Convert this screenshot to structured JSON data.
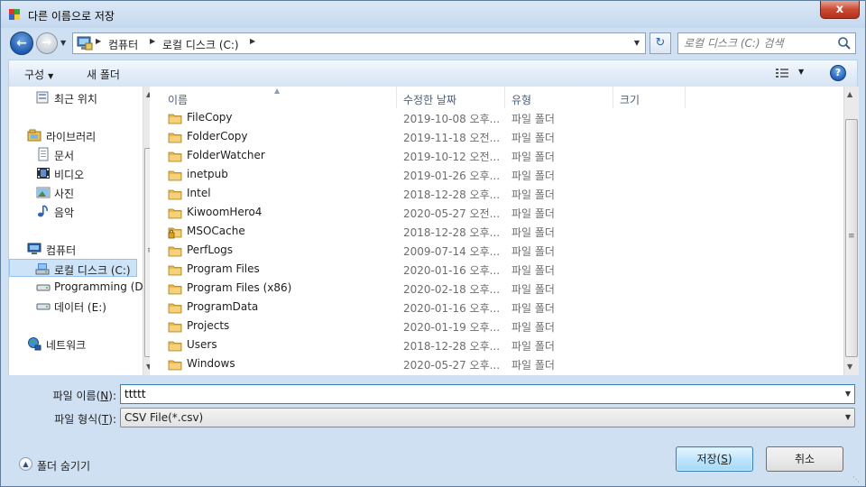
{
  "window": {
    "title": "다른 이름으로 저장",
    "close_label": "x"
  },
  "address": {
    "crumbs": [
      "컴퓨터",
      "로컬 디스크 (C:)"
    ]
  },
  "search": {
    "placeholder": "로컬 디스크 (C:) 검색"
  },
  "toolbar": {
    "organize_label": "구성",
    "new_folder_label": "새 폴더",
    "help_label": "?"
  },
  "nav": {
    "items": [
      {
        "label": "최근 위치",
        "icon": "recent-places-icon"
      },
      {
        "label": "라이브러리",
        "icon": "libraries-icon"
      },
      {
        "label": "문서",
        "icon": "documents-icon"
      },
      {
        "label": "비디오",
        "icon": "videos-icon"
      },
      {
        "label": "사진",
        "icon": "pictures-icon"
      },
      {
        "label": "음악",
        "icon": "music-icon"
      },
      {
        "label": "컴퓨터",
        "icon": "computer-icon"
      },
      {
        "label": "로컬 디스크 (C:)",
        "icon": "local-disk-icon",
        "selected": true
      },
      {
        "label": "Programming (D",
        "icon": "drive-icon"
      },
      {
        "label": "데이터 (E:)",
        "icon": "drive-icon"
      },
      {
        "label": "네트워크",
        "icon": "network-icon"
      }
    ]
  },
  "columns": {
    "name": "이름",
    "modified": "수정한 날짜",
    "type": "유형",
    "size": "크기"
  },
  "files": [
    {
      "name": "FileCopy",
      "date": "2019-10-08 오후...",
      "type": "파일 폴더",
      "icon": "folder-icon"
    },
    {
      "name": "FolderCopy",
      "date": "2019-11-18 오전...",
      "type": "파일 폴더",
      "icon": "folder-icon"
    },
    {
      "name": "FolderWatcher",
      "date": "2019-10-12 오전...",
      "type": "파일 폴더",
      "icon": "folder-icon"
    },
    {
      "name": "inetpub",
      "date": "2019-01-26 오후...",
      "type": "파일 폴더",
      "icon": "folder-icon"
    },
    {
      "name": "Intel",
      "date": "2018-12-28 오후...",
      "type": "파일 폴더",
      "icon": "folder-icon"
    },
    {
      "name": "KiwoomHero4",
      "date": "2020-05-27 오전...",
      "type": "파일 폴더",
      "icon": "folder-icon"
    },
    {
      "name": "MSOCache",
      "date": "2018-12-28 오후...",
      "type": "파일 폴더",
      "icon": "locked-folder-icon"
    },
    {
      "name": "PerfLogs",
      "date": "2009-07-14 오후...",
      "type": "파일 폴더",
      "icon": "folder-icon"
    },
    {
      "name": "Program Files",
      "date": "2020-01-16 오후...",
      "type": "파일 폴더",
      "icon": "folder-icon"
    },
    {
      "name": "Program Files (x86)",
      "date": "2020-02-18 오후...",
      "type": "파일 폴더",
      "icon": "folder-icon"
    },
    {
      "name": "ProgramData",
      "date": "2020-01-16 오후...",
      "type": "파일 폴더",
      "icon": "folder-icon"
    },
    {
      "name": "Projects",
      "date": "2020-01-19 오후...",
      "type": "파일 폴더",
      "icon": "folder-icon"
    },
    {
      "name": "Users",
      "date": "2018-12-28 오후...",
      "type": "파일 폴더",
      "icon": "folder-icon"
    },
    {
      "name": "Windows",
      "date": "2020-05-27 오후...",
      "type": "파일 폴더",
      "icon": "folder-icon"
    }
  ],
  "filename": {
    "label_prefix": "파일 이름(",
    "label_key": "N",
    "label_suffix": "):",
    "value": "ttttt"
  },
  "filetype": {
    "label_prefix": "파일 형식(",
    "label_key": "T",
    "label_suffix": "):",
    "value": "CSV File(*.csv)"
  },
  "footer": {
    "hide_folders_label": "폴더 숨기기",
    "save_prefix": "저장(",
    "save_key": "S",
    "save_suffix": ")",
    "cancel_label": "취소"
  },
  "colors": {
    "frame": "#cfe0f2",
    "accent": "#3c7fb1",
    "folder": "#e8b84a",
    "selected": "#cde3f8"
  }
}
